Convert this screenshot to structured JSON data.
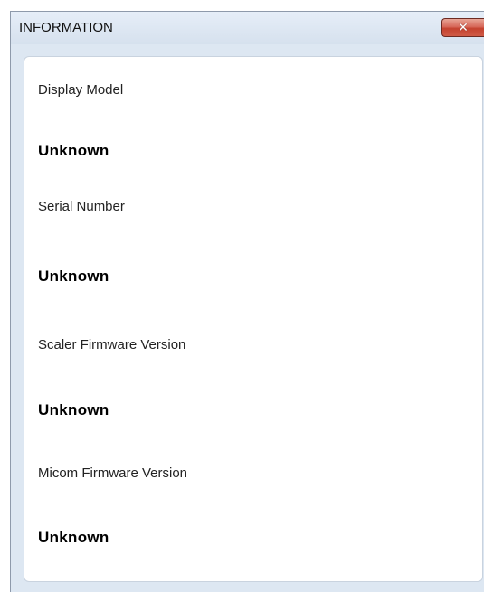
{
  "window": {
    "title": "INFORMATION",
    "close_icon": "close-icon",
    "close_glyph": "✕"
  },
  "info": {
    "display_model": {
      "label": "Display Model",
      "value": "Unknown"
    },
    "serial_number": {
      "label": "Serial Number",
      "value": "Unknown"
    },
    "scaler_firmware": {
      "label": "Scaler Firmware Version",
      "value": "Unknown"
    },
    "micom_firmware": {
      "label": "Micom Firmware Version",
      "value": "Unknown"
    }
  },
  "colors": {
    "titlebar": "#dde7f2",
    "close_button": "#c4422f",
    "panel_border": "#c9d3df"
  }
}
